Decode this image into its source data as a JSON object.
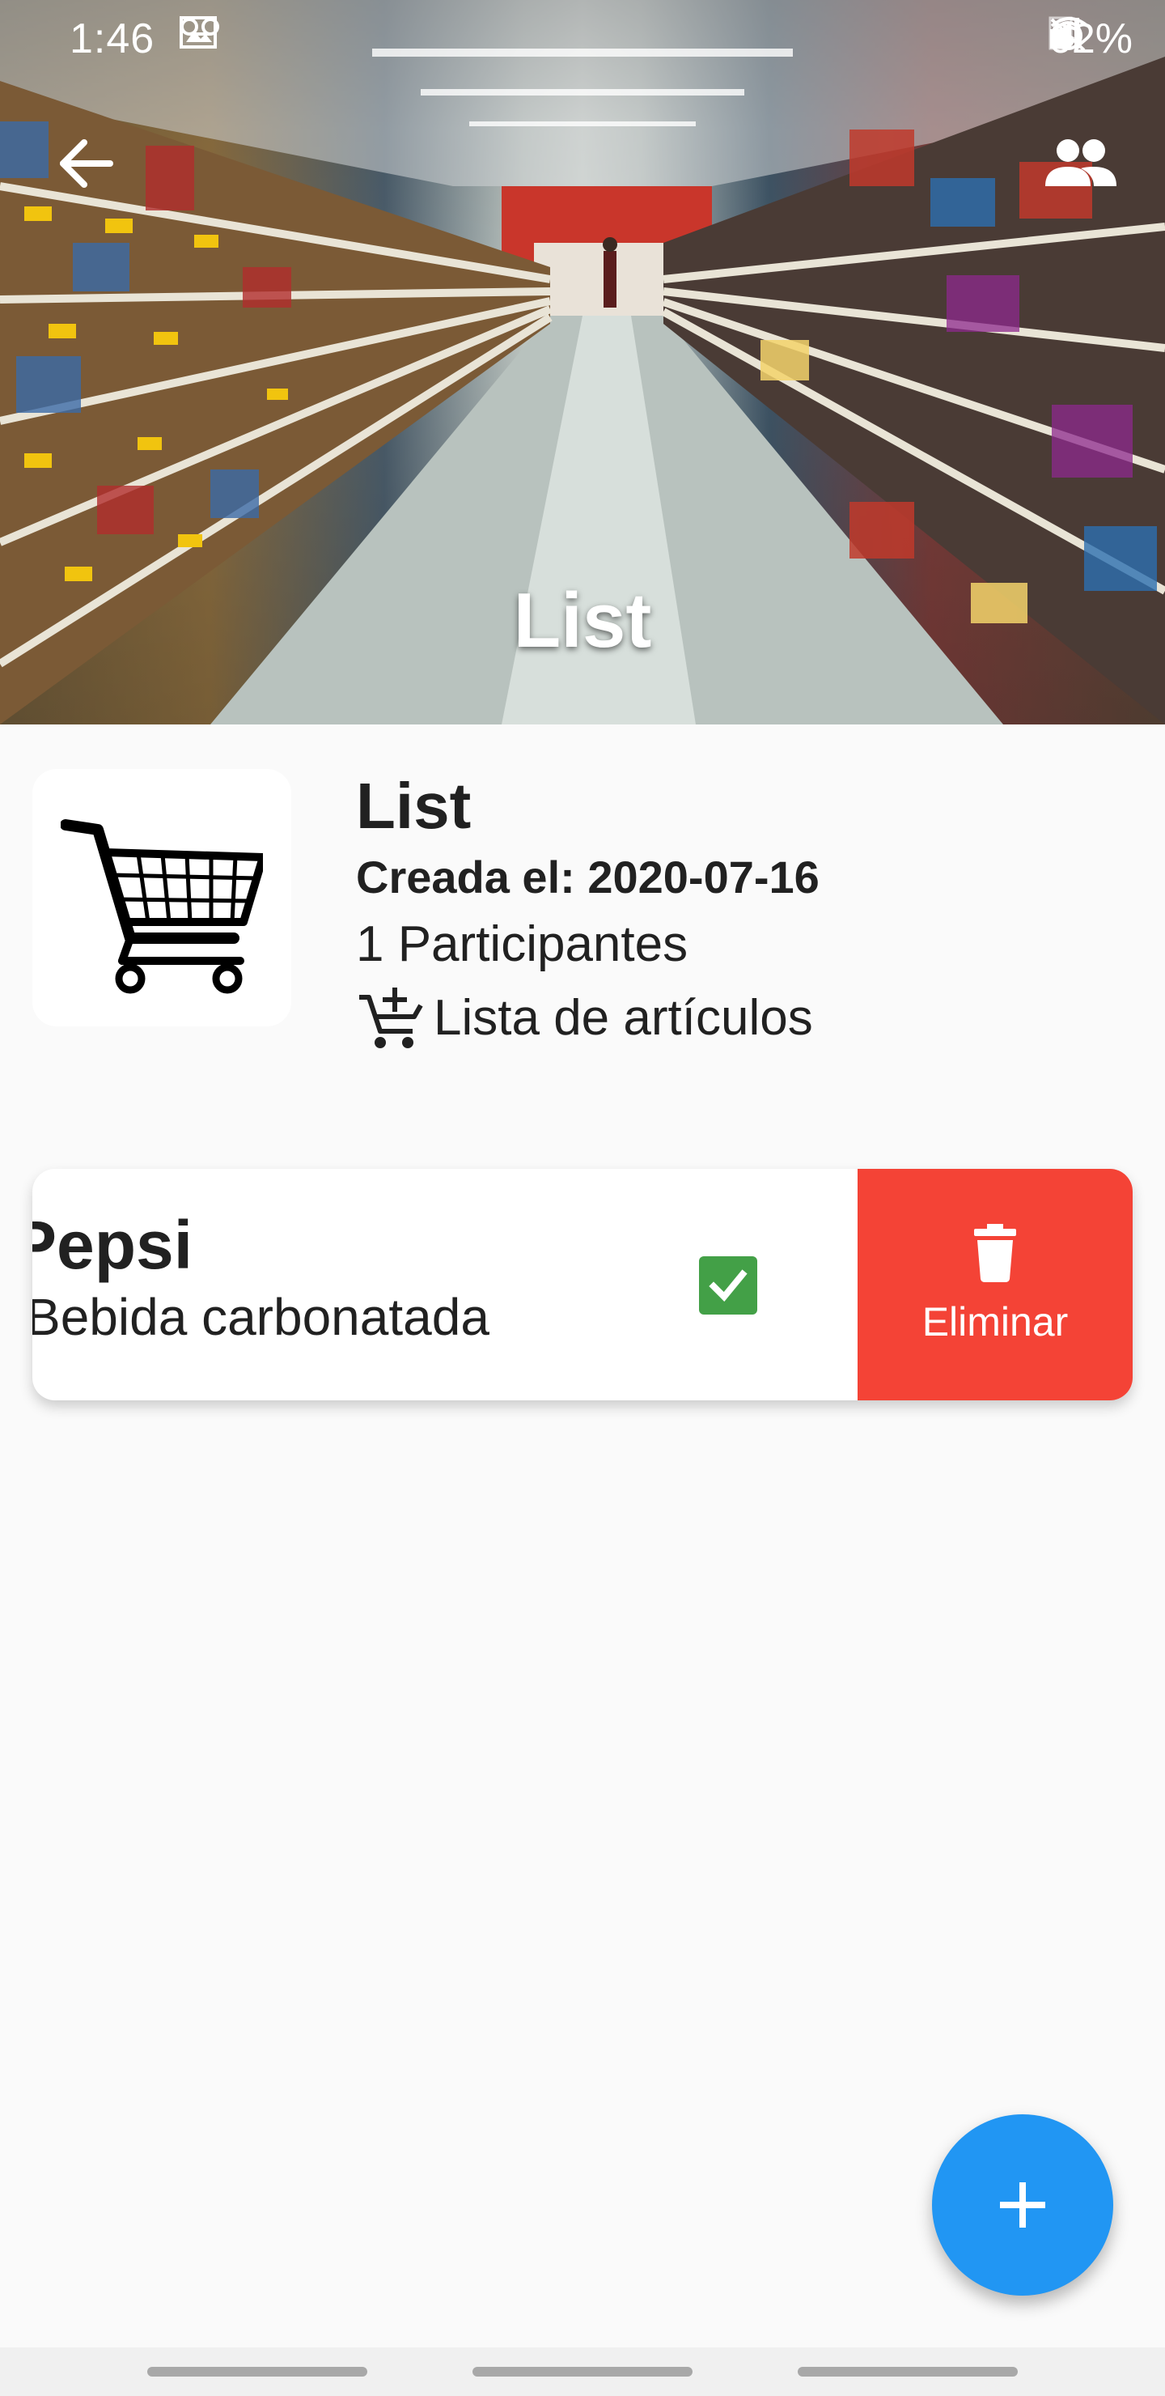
{
  "status_bar": {
    "time": "1:46",
    "battery": "62%",
    "left_icons": [
      "image-icon",
      "voicemail-icon"
    ],
    "right_icons": [
      "alarm-icon",
      "mute-icon",
      "wifi-icon",
      "signal-icon",
      "battery-icon"
    ]
  },
  "header": {
    "title": "List",
    "back_icon": "arrow-back-icon",
    "participants_icon": "people-icon"
  },
  "list_info": {
    "name": "List",
    "created": "Creada el: 2020-07-16",
    "participants": "1 Participantes",
    "articles_label": "Lista de artículos",
    "thumbnail_icon": "shopping-cart-icon"
  },
  "items": [
    {
      "name": "Pepsi",
      "description": "Bebida carbonatada",
      "checked": true,
      "delete_label": "Eliminar"
    }
  ],
  "fab": {
    "icon": "plus-icon"
  },
  "colors": {
    "delete": "#f44336",
    "fab": "#2196f3",
    "check": "#43a047",
    "background": "#fafafa"
  }
}
